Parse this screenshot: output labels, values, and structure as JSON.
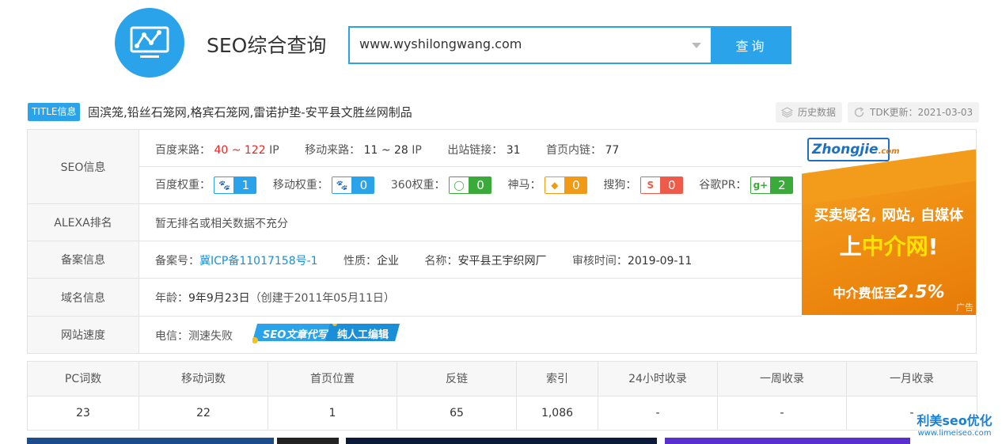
{
  "header": {
    "app_title": "SEO综合查询",
    "search_value": "www.wyshilongwang.com",
    "search_button": "查询"
  },
  "title_line": {
    "badge": "TITLE信息",
    "title": "固滨笼,铅丝石笼网,格宾石笼网,雷诺护垫-安平县文胜丝网制品",
    "history": "历史数据",
    "tdk": "TDK更新：2021-03-03"
  },
  "seo_info": {
    "label": "SEO信息",
    "baidu_traffic_label": "百度来路：",
    "baidu_traffic_value": "40 ~ 122",
    "baidu_traffic_unit": "IP",
    "mobile_traffic_label": "移动来路：",
    "mobile_traffic_value": "11 ~ 28",
    "mobile_traffic_unit": "IP",
    "outbound_label": "出站链接：",
    "outbound_value": "31",
    "internal_label": "首页内链：",
    "internal_value": "77",
    "weights": [
      {
        "label": "百度权重：",
        "value": "1",
        "color": "#2aa3ea",
        "icon": "paw-icon"
      },
      {
        "label": "移动权重：",
        "value": "0",
        "color": "#2aa3ea",
        "icon": "paw-mobile-icon"
      },
      {
        "label": "360权重：",
        "value": "0",
        "color": "#3aab3a",
        "icon": "360-icon"
      },
      {
        "label": "神马：",
        "value": "0",
        "color": "#f09a18",
        "icon": "shenma-icon"
      },
      {
        "label": "搜狗：",
        "value": "0",
        "color": "#ee5b4a",
        "icon": "sogou-icon"
      },
      {
        "label": "谷歌PR：",
        "value": "2",
        "color": "#3aab3a",
        "icon": "google-plus-icon"
      }
    ]
  },
  "alexa": {
    "label": "ALEXA排名",
    "value": "暂无排名或相关数据不充分"
  },
  "beian": {
    "label": "备案信息",
    "no_label": "备案号：",
    "no_value": "冀ICP备11017158号-1",
    "nature_label": "性质：",
    "nature_value": "企业",
    "name_label": "名称：",
    "name_value": "安平县王宇织网厂",
    "audit_label": "审核时间：",
    "audit_value": "2019-09-11"
  },
  "domain": {
    "label": "域名信息",
    "age_label": "年龄：",
    "age_value": "9年9月23日",
    "created": "（创建于2011年05月11日）"
  },
  "speed": {
    "label": "网站速度",
    "value": "电信：测速失败",
    "badge_left": "SEO文章代写",
    "badge_right": "纯人工编辑"
  },
  "ad": {
    "brand": "Zhongjie",
    "brand_suffix": ".com",
    "line1": "买卖域名, 网站, 自媒体",
    "line2_pre": "上",
    "line2_hl": "中介网",
    "line2_post": "!",
    "line3_pre": "中介费低至",
    "line3_big": "2.5%",
    "tag": "广告"
  },
  "stats": {
    "headers": [
      "PC词数",
      "移动词数",
      "首页位置",
      "反链",
      "索引",
      "24小时收录",
      "一周收录",
      "一月收录"
    ],
    "values": [
      "23",
      "22",
      "1",
      "65",
      "1,086",
      "-",
      "-",
      "-"
    ]
  },
  "watermark": {
    "main": "利美seo优化",
    "sub": "www.limeiseo.com"
  }
}
